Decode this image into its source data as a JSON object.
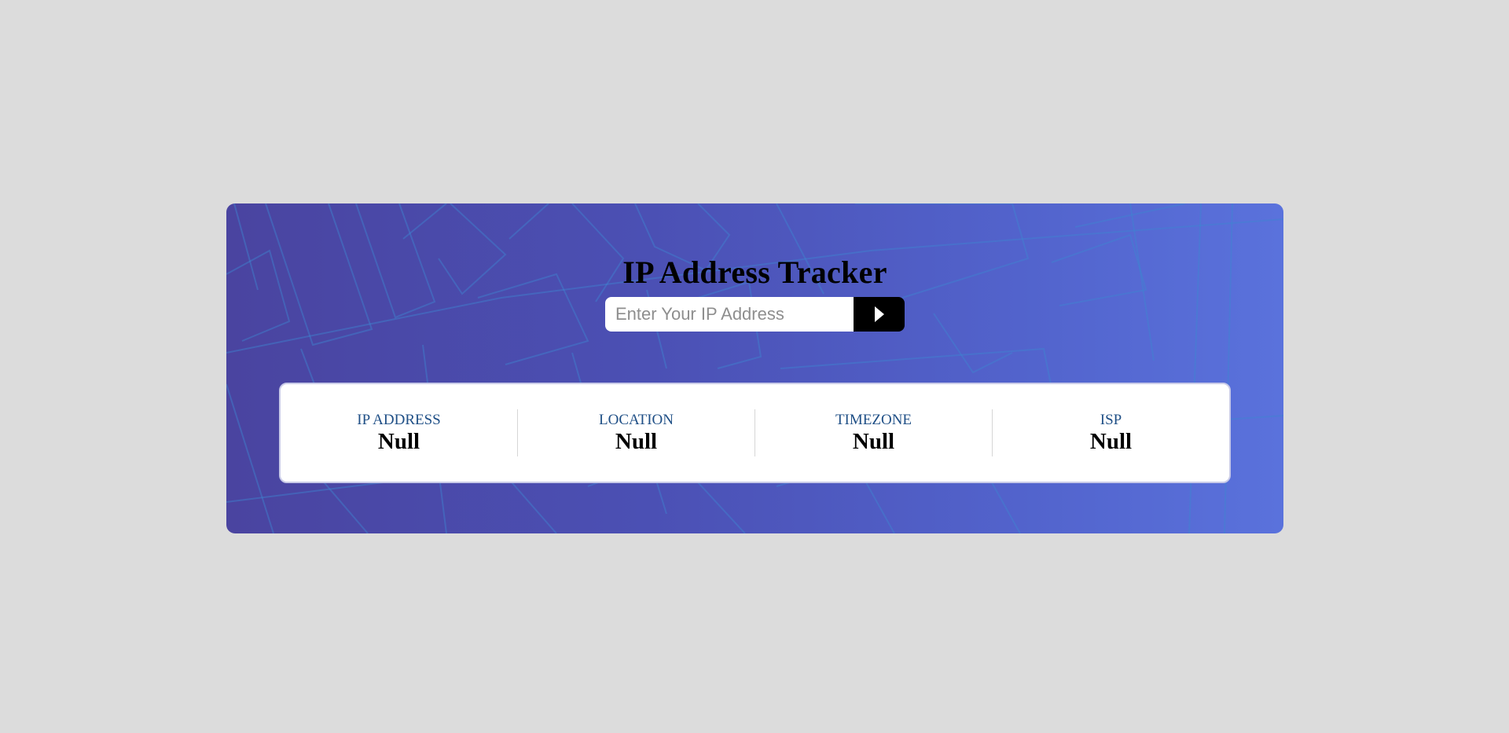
{
  "header": {
    "title": "IP Address Tracker"
  },
  "search": {
    "placeholder": "Enter Your IP Address",
    "value": "",
    "submit_icon": "play-arrow-icon"
  },
  "info": {
    "items": [
      {
        "label": "IP ADDRESS",
        "value": "Null"
      },
      {
        "label": "LOCATION",
        "value": "Null"
      },
      {
        "label": "TIMEZONE",
        "value": "Null"
      },
      {
        "label": "ISP",
        "value": "Null"
      }
    ]
  },
  "colors": {
    "page_background": "#dcdcdc",
    "hero_gradient_start": "#4a44a0",
    "hero_gradient_end": "#5a72dc",
    "label_color": "#1f4f86",
    "button_background": "#000000"
  }
}
